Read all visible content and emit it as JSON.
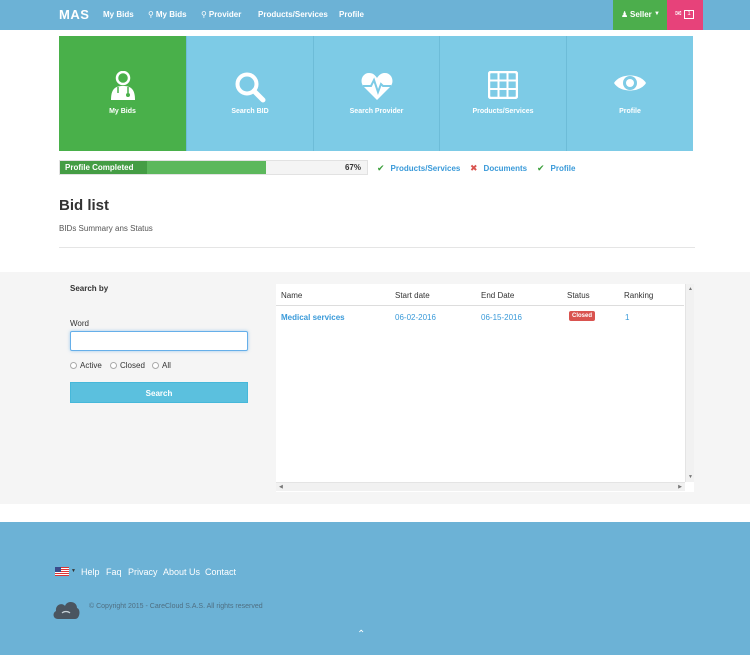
{
  "nav": {
    "brand": "MAS",
    "links": [
      "My Bids",
      "My Bids",
      "Provider",
      "Products/Services",
      "Profile"
    ],
    "seller_label": "Seller",
    "mail_count": "1"
  },
  "tiles": [
    {
      "label": "My Bids",
      "icon": "doctor-icon"
    },
    {
      "label": "Search BID",
      "icon": "search-icon"
    },
    {
      "label": "Search Provider",
      "icon": "heartbeat-icon"
    },
    {
      "label": "Products/Services",
      "icon": "grid-icon"
    },
    {
      "label": "Profile",
      "icon": "eye-icon"
    }
  ],
  "profile": {
    "progress_label": "Profile Completed",
    "progress_value": 0.67,
    "progress_text": "67%",
    "checks": [
      {
        "label": "Products/Services",
        "status": "done"
      },
      {
        "label": "Documents",
        "status": "missing"
      },
      {
        "label": "Profile",
        "status": "done"
      }
    ]
  },
  "page": {
    "title": "Bid list",
    "subtitle": "BIDs Summary ans Status"
  },
  "search": {
    "title": "Search by",
    "word_label": "Word",
    "word_value": "",
    "options": [
      "Active",
      "Closed",
      "All"
    ],
    "button": "Search"
  },
  "table": {
    "headers": [
      "Name",
      "Start date",
      "End Date",
      "Status",
      "Ranking"
    ],
    "rows": [
      {
        "name": "Medical services",
        "start": "06-02-2016",
        "end": "06-15-2016",
        "status": "Closed",
        "ranking": "1"
      }
    ]
  },
  "footer": {
    "links": [
      "Help",
      "Faq",
      "Privacy",
      "About Us",
      "Contact"
    ],
    "copyright": "© Copyright 2015 - CareCloud S.A.S. All rights reserved"
  },
  "colors": {
    "nav": "#6cb2d6",
    "tile": "#7dcbe6",
    "tile_active": "#49b04a",
    "seller": "#4cae4c",
    "mail": "#e7427a",
    "link": "#3a9ad9",
    "closed": "#d9534f"
  }
}
